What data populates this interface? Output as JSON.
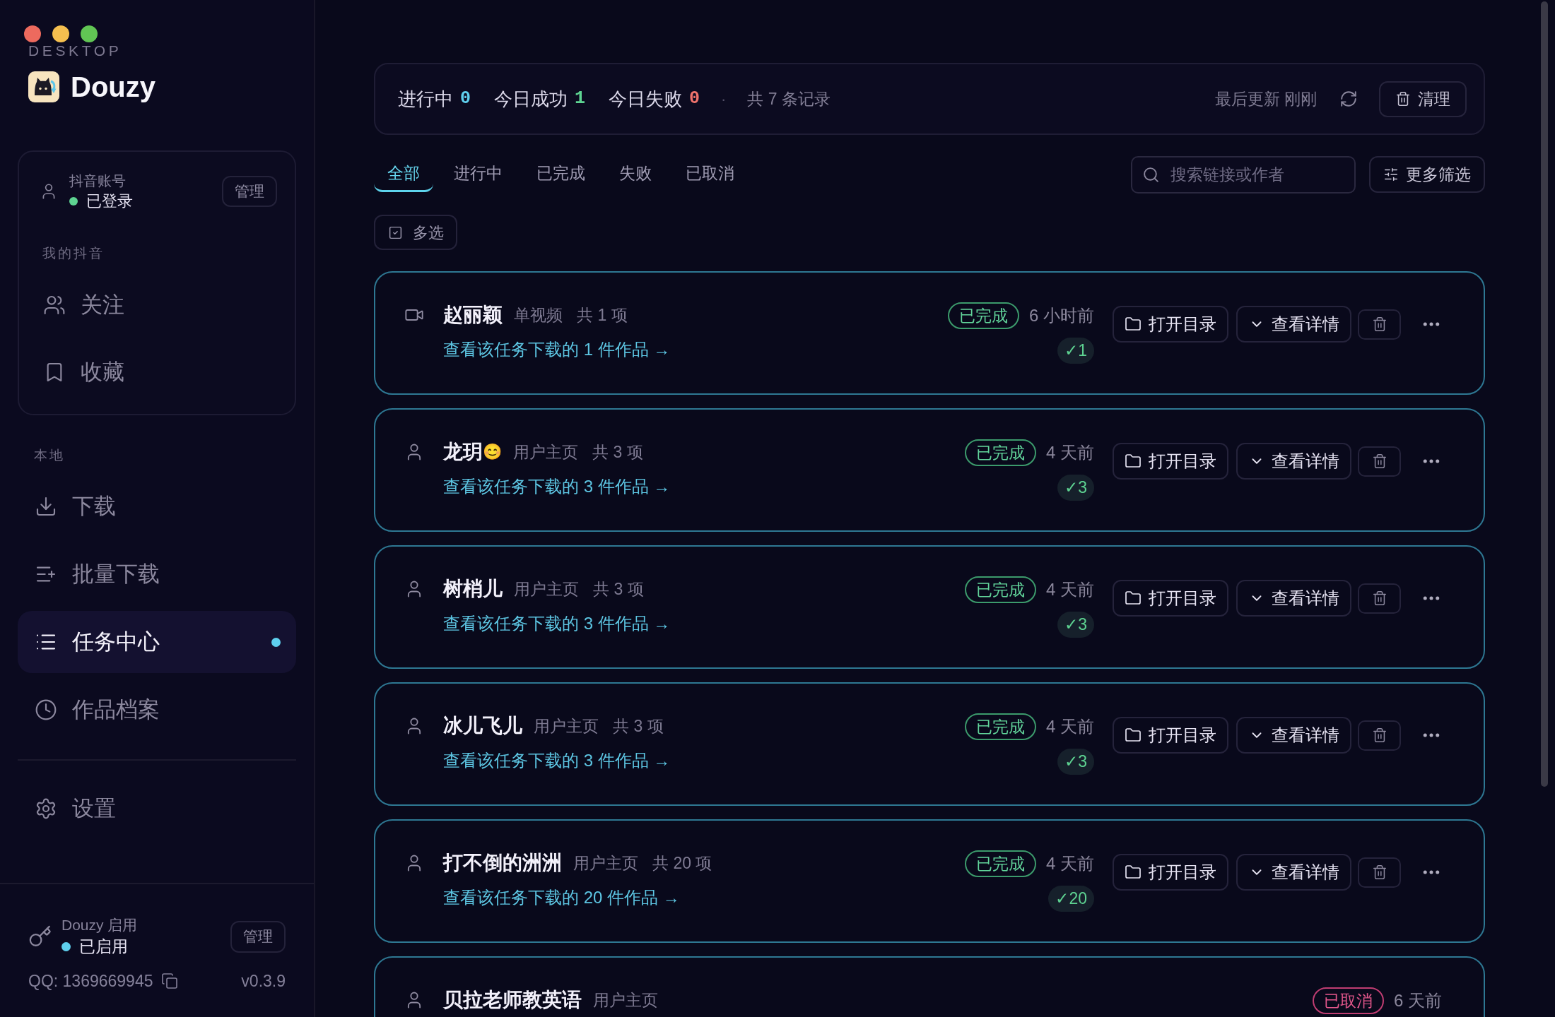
{
  "sidebar": {
    "brand": {
      "caption": "DESKTOP",
      "name": "Douzy"
    },
    "account": {
      "label": "抖音账号",
      "status": "已登录",
      "logged_in": true,
      "button": "管理"
    },
    "mine": {
      "heading": "我的抖音",
      "items": [
        {
          "label": "关注",
          "selected": false
        },
        {
          "label": "收藏",
          "selected": false
        }
      ]
    },
    "local": {
      "heading": "本地",
      "items": [
        {
          "label": "下载",
          "selected": false,
          "dot": false
        },
        {
          "label": "批量下载",
          "selected": false,
          "dot": false
        },
        {
          "label": "任务中心",
          "selected": true,
          "dot": true
        },
        {
          "label": "作品档案",
          "selected": false,
          "dot": false
        }
      ]
    },
    "settings": {
      "label": "设置",
      "selected": false
    },
    "license": {
      "label": "Douzy 启用",
      "status": "已启用",
      "enabled": true,
      "button": "管理"
    },
    "qq": "QQ: 1369669945",
    "version": "v0.3.9"
  },
  "summary": {
    "stats": [
      {
        "kind": "running",
        "label": "进行中",
        "value": "0"
      },
      {
        "kind": "success",
        "label": "今日成功",
        "value": "1"
      },
      {
        "kind": "failed",
        "label": "今日失败",
        "value": "0"
      }
    ],
    "separator": "·",
    "total": "共 7 条记录",
    "updated": "最后更新 刚刚",
    "clear_button": "清理"
  },
  "tabs": [
    {
      "label": "全部",
      "selected": true
    },
    {
      "label": "进行中",
      "selected": false
    },
    {
      "label": "已完成",
      "selected": false
    },
    {
      "label": "失败",
      "selected": false
    },
    {
      "label": "已取消",
      "selected": false
    }
  ],
  "search": {
    "placeholder": "搜索链接或作者"
  },
  "filter_button": "更多筛选",
  "multi_select_button": "多选",
  "tasks": [
    {
      "kind": "video",
      "title": "赵丽颖",
      "type": "单视频",
      "count": "共 1 项",
      "link": "查看该任务下载的 1 件作品 →",
      "status": {
        "kind": "done",
        "label": "已完成"
      },
      "time": "6 小时前",
      "success": "✓1",
      "actions": [
        "打开目录",
        "查看详情"
      ]
    },
    {
      "kind": "user",
      "title": "龙玥",
      "title_emoji": "😊",
      "type": "用户主页",
      "count": "共 3 项",
      "link": "查看该任务下载的 3 件作品 →",
      "status": {
        "kind": "done",
        "label": "已完成"
      },
      "time": "4 天前",
      "success": "✓3",
      "actions": [
        "打开目录",
        "查看详情"
      ]
    },
    {
      "kind": "user",
      "title": "树梢儿",
      "type": "用户主页",
      "count": "共 3 项",
      "link": "查看该任务下载的 3 件作品 →",
      "status": {
        "kind": "done",
        "label": "已完成"
      },
      "time": "4 天前",
      "success": "✓3",
      "actions": [
        "打开目录",
        "查看详情"
      ]
    },
    {
      "kind": "user",
      "title": "冰儿飞儿",
      "type": "用户主页",
      "count": "共 3 项",
      "link": "查看该任务下载的 3 件作品 →",
      "status": {
        "kind": "done",
        "label": "已完成"
      },
      "time": "4 天前",
      "success": "✓3",
      "actions": [
        "打开目录",
        "查看详情"
      ]
    },
    {
      "kind": "user",
      "title": "打不倒的洲洲",
      "type": "用户主页",
      "count": "共 20 项",
      "link": "查看该任务下载的 20 件作品 →",
      "status": {
        "kind": "done",
        "label": "已完成"
      },
      "time": "4 天前",
      "success": "✓20",
      "actions": [
        "打开目录",
        "查看详情"
      ]
    },
    {
      "kind": "user",
      "title": "贝拉老师教英语",
      "type": "用户主页",
      "status": {
        "kind": "cancelled",
        "label": "已取消"
      },
      "time": "6 天前"
    }
  ]
}
